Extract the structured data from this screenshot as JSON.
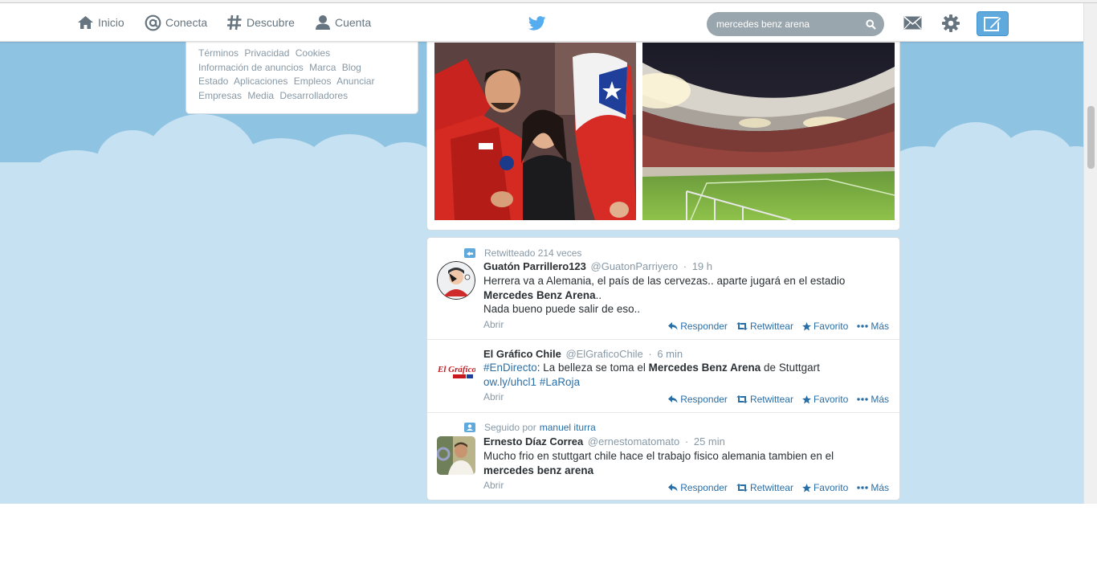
{
  "nav": {
    "home": "Inicio",
    "connect": "Conecta",
    "discover": "Descubre",
    "account": "Cuenta"
  },
  "search": {
    "value": "mercedes benz arena"
  },
  "footer": {
    "links": [
      "Términos",
      "Privacidad",
      "Cookies",
      "Información de anuncios",
      "Marca",
      "Blog",
      "Estado",
      "Aplicaciones",
      "Empleos",
      "Anunciar",
      "Empresas",
      "Media",
      "Desarrolladores"
    ]
  },
  "tweets": [
    {
      "context": "Retwitteado 214 veces",
      "context_link": "",
      "fullname": "Guatón Parrillero123",
      "username": "@GuatonParriyero",
      "time": "19 h",
      "line1": "Herrera va a Alemania, el país de las cervezas.. aparte jugará en el estadio",
      "line2_bold": "Mercedes Benz Arena",
      "line2_rest": "..",
      "line3": "Nada bueno puede salir de eso..",
      "open": "Abrir"
    },
    {
      "context": "",
      "context_link": "",
      "fullname": "El Gráfico Chile",
      "username": "@ElGraficoChile",
      "time": "6 min",
      "hashtag1": "#EnDirecto",
      "text_a": ": La belleza se toma el ",
      "text_bold": "Mercedes Benz Arena",
      "text_b": " de Stuttgart",
      "url": "ow.ly/uhcl1",
      "hashtag2": "#LaRoja",
      "open": "Abrir"
    },
    {
      "context": "Seguido por",
      "context_link": "manuel iturra",
      "fullname": "Ernesto Díaz Correa",
      "username": "@ernestomatomato",
      "time": "25 min",
      "line1": "Mucho frio en stuttgart chile hace el trabajo fisico alemania tambien en el",
      "line2_bold": "mercedes benz arena",
      "open": "Abrir"
    }
  ],
  "actions": {
    "reply": "Responder",
    "retweet": "Retwittear",
    "favorite": "Favorito",
    "more": "Más"
  },
  "avatar_labels": {
    "elgrafico": "El Gráfico"
  },
  "colors": {
    "link": "#2a6ea6",
    "sky": "#8fc3e2",
    "cloud": "#c5e1f2",
    "compose": "#5fa9dd"
  },
  "icons": [
    "home-icon",
    "at-icon",
    "hash-icon",
    "person-icon",
    "twitter-bird-icon",
    "search-icon",
    "envelope-icon",
    "gear-icon",
    "compose-icon",
    "retweet-icon",
    "follow-icon",
    "reply-icon",
    "favorite-star-icon",
    "more-dots-icon"
  ]
}
